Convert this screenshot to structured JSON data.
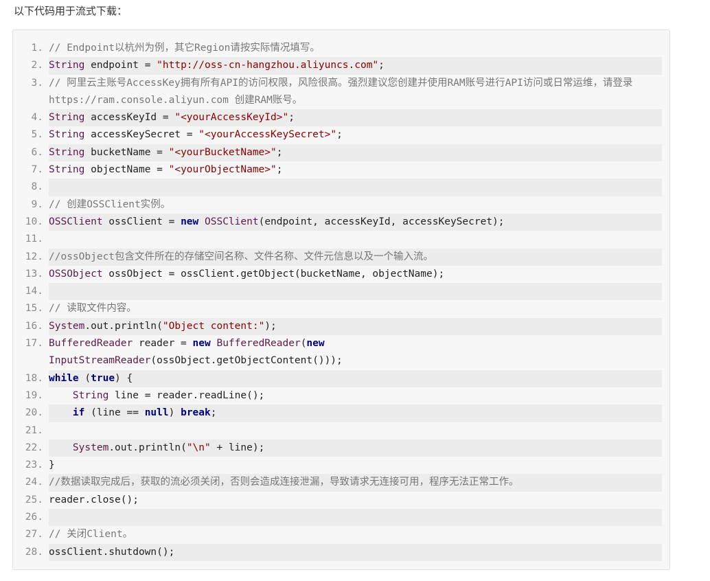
{
  "intro": "以下代码用于流式下载：",
  "lines": [
    {
      "n": "1.",
      "parts": [
        {
          "t": "// Endpoint以杭州为例，其它Region请按实际情况填写。",
          "c": "cm"
        }
      ]
    },
    {
      "n": "2.",
      "parts": [
        {
          "t": "String",
          "c": "ty"
        },
        {
          "t": " endpoint = ",
          "c": "op"
        },
        {
          "t": "\"http://oss-cn-hangzhou.aliyuncs.com\"",
          "c": "st"
        },
        {
          "t": ";",
          "c": "op"
        }
      ]
    },
    {
      "n": "3.",
      "wrap": true,
      "parts": [
        {
          "t": "// 阿里云主账号AccessKey拥有所有API的访问权限，风险很高。强烈建议您创建并使用RAM账号进行API访问或日常运维，请登录 https://ram.console.aliyun.com 创建RAM账号。",
          "c": "cm"
        }
      ]
    },
    {
      "n": "4.",
      "parts": [
        {
          "t": "String",
          "c": "ty"
        },
        {
          "t": " accessKeyId = ",
          "c": "op"
        },
        {
          "t": "\"<yourAccessKeyId>\"",
          "c": "st"
        },
        {
          "t": ";",
          "c": "op"
        }
      ]
    },
    {
      "n": "5.",
      "parts": [
        {
          "t": "String",
          "c": "ty"
        },
        {
          "t": " accessKeySecret = ",
          "c": "op"
        },
        {
          "t": "\"<yourAccessKeySecret>\"",
          "c": "st"
        },
        {
          "t": ";",
          "c": "op"
        }
      ]
    },
    {
      "n": "6.",
      "parts": [
        {
          "t": "String",
          "c": "ty"
        },
        {
          "t": " bucketName = ",
          "c": "op"
        },
        {
          "t": "\"<yourBucketName>\"",
          "c": "st"
        },
        {
          "t": ";",
          "c": "op"
        }
      ]
    },
    {
      "n": "7.",
      "parts": [
        {
          "t": "String",
          "c": "ty"
        },
        {
          "t": " objectName = ",
          "c": "op"
        },
        {
          "t": "\"<yourObjectName>\"",
          "c": "st"
        },
        {
          "t": ";",
          "c": "op"
        }
      ]
    },
    {
      "n": "8.",
      "parts": []
    },
    {
      "n": "9.",
      "parts": [
        {
          "t": "// 创建OSSClient实例。",
          "c": "cm"
        }
      ]
    },
    {
      "n": "10.",
      "parts": [
        {
          "t": "OSSClient",
          "c": "ty"
        },
        {
          "t": " ossClient = ",
          "c": "op"
        },
        {
          "t": "new",
          "c": "kw"
        },
        {
          "t": " ",
          "c": "op"
        },
        {
          "t": "OSSClient",
          "c": "ty"
        },
        {
          "t": "(endpoint, accessKeyId, accessKeySecret);",
          "c": "op"
        }
      ]
    },
    {
      "n": "11.",
      "parts": []
    },
    {
      "n": "12.",
      "parts": [
        {
          "t": "//ossObject包含文件所在的存储空间名称、文件名称、文件元信息以及一个输入流。",
          "c": "cm"
        }
      ]
    },
    {
      "n": "13.",
      "parts": [
        {
          "t": "OSSObject",
          "c": "ty"
        },
        {
          "t": " ossObject = ossClient.getObject(bucketName, objectName);",
          "c": "op"
        }
      ]
    },
    {
      "n": "14.",
      "parts": []
    },
    {
      "n": "15.",
      "parts": [
        {
          "t": "// 读取文件内容。",
          "c": "cm"
        }
      ]
    },
    {
      "n": "16.",
      "parts": [
        {
          "t": "System",
          "c": "ty"
        },
        {
          "t": ".out.println(",
          "c": "op"
        },
        {
          "t": "\"Object content:\"",
          "c": "st"
        },
        {
          "t": ");",
          "c": "op"
        }
      ]
    },
    {
      "n": "17.",
      "wrap": true,
      "parts": [
        {
          "t": "BufferedReader",
          "c": "ty"
        },
        {
          "t": " reader = ",
          "c": "op"
        },
        {
          "t": "new",
          "c": "kw"
        },
        {
          "t": " ",
          "c": "op"
        },
        {
          "t": "BufferedReader",
          "c": "ty"
        },
        {
          "t": "(",
          "c": "op"
        },
        {
          "t": "new",
          "c": "kw"
        },
        {
          "t": "\n",
          "c": "op"
        },
        {
          "t": "InputStreamReader",
          "c": "ty"
        },
        {
          "t": "(ossObject.getObjectContent()));",
          "c": "op"
        }
      ]
    },
    {
      "n": "18.",
      "parts": [
        {
          "t": "while",
          "c": "kw"
        },
        {
          "t": " (",
          "c": "op"
        },
        {
          "t": "true",
          "c": "kw"
        },
        {
          "t": ") {",
          "c": "op"
        }
      ]
    },
    {
      "n": "19.",
      "parts": [
        {
          "t": "    ",
          "c": "op"
        },
        {
          "t": "String",
          "c": "ty"
        },
        {
          "t": " line = reader.readLine();",
          "c": "op"
        }
      ]
    },
    {
      "n": "20.",
      "parts": [
        {
          "t": "    ",
          "c": "op"
        },
        {
          "t": "if",
          "c": "kw"
        },
        {
          "t": " (line == ",
          "c": "op"
        },
        {
          "t": "null",
          "c": "kw"
        },
        {
          "t": ") ",
          "c": "op"
        },
        {
          "t": "break",
          "c": "kw"
        },
        {
          "t": ";",
          "c": "op"
        }
      ]
    },
    {
      "n": "21.",
      "parts": []
    },
    {
      "n": "22.",
      "parts": [
        {
          "t": "    ",
          "c": "op"
        },
        {
          "t": "System",
          "c": "ty"
        },
        {
          "t": ".out.println(",
          "c": "op"
        },
        {
          "t": "\"\\n\"",
          "c": "st"
        },
        {
          "t": " + line);",
          "c": "op"
        }
      ]
    },
    {
      "n": "23.",
      "parts": [
        {
          "t": "}",
          "c": "op"
        }
      ]
    },
    {
      "n": "24.",
      "parts": [
        {
          "t": "//数据读取完成后，获取的流必须关闭，否则会造成连接泄漏，导致请求无连接可用，程序无法正常工作。",
          "c": "cm"
        }
      ]
    },
    {
      "n": "25.",
      "parts": [
        {
          "t": "reader.close();",
          "c": "op"
        }
      ]
    },
    {
      "n": "26.",
      "parts": []
    },
    {
      "n": "27.",
      "parts": [
        {
          "t": "// 关闭Client。",
          "c": "cm"
        }
      ]
    },
    {
      "n": "28.",
      "parts": [
        {
          "t": "ossClient.shutdown();",
          "c": "op"
        }
      ]
    }
  ]
}
